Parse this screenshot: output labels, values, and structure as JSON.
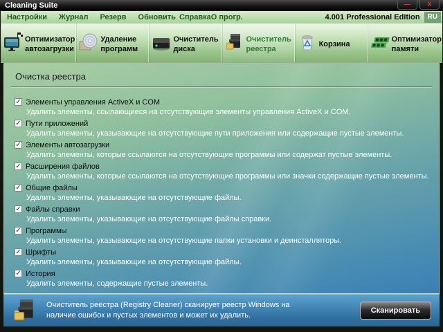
{
  "window": {
    "title": "Cleaning Suite",
    "minimize_label": "—",
    "close_label": "X"
  },
  "menu": {
    "items": [
      "Настройки",
      "Журнал",
      "Резерв",
      "Обновить",
      "Справка",
      "О прогр."
    ],
    "edition": "4.001 Professional Edition",
    "language": "RU"
  },
  "tabs": [
    {
      "label": "Оптимизатор автозагрузки",
      "icon": "startup-optimizer-icon",
      "active": false
    },
    {
      "label": "Удаление программ",
      "icon": "uninstall-icon",
      "active": false
    },
    {
      "label": "Очиститель диска",
      "icon": "disk-cleaner-icon",
      "active": false
    },
    {
      "label": "Очиститель реестра",
      "icon": "registry-cleaner-icon",
      "active": true
    },
    {
      "label": "Корзина",
      "icon": "recycle-bin-icon",
      "active": false
    },
    {
      "label": "Оптимизатор памяти",
      "icon": "memory-optimizer-icon",
      "active": false
    }
  ],
  "content": {
    "heading": "Очистка реестра",
    "items": [
      {
        "label": "Элементы управления ActiveX и COM",
        "description": "Удалить элементы, ссылающиеся на отсутствующие элементы управления ActiveX и COM.",
        "checked": true
      },
      {
        "label": "Пути приложений",
        "description": "Удалить элементы, указывающие на отсутствующие пути приложения или содержащие пустые элементы.",
        "checked": true
      },
      {
        "label": "Элементы автозагрузки",
        "description": "Удалить элементы, которые ссылаются на отсутствующие программы или содержат пустые элементы.",
        "checked": true
      },
      {
        "label": "Расширения файлов",
        "description": "Удалить элементы, которые ссылаются на отсутствующие программы или значки содержащие пустые элементы.",
        "checked": true
      },
      {
        "label": "Общие файлы",
        "description": "Удалить элементы, указывающие на отсутствующие файлы.",
        "checked": true
      },
      {
        "label": "Файлы справки",
        "description": "Удалить элементы, указывающие на отсутствующие файлы справки.",
        "checked": true
      },
      {
        "label": "Программы",
        "description": "Удалить элементы, указывающие на отсутствующие папки установки и деинсталляторы.",
        "checked": true
      },
      {
        "label": "Шрифты",
        "description": "Удалить элементы, указывающие на отсутствующие файлы.",
        "checked": true
      },
      {
        "label": "История",
        "description": "Удалить элементы, содержащие пустые элементы.",
        "checked": true
      }
    ]
  },
  "footer": {
    "description": "Очиститель реестра (Registry Cleaner) сканирует реестр Windows на наличие ошибок и пустых элементов и может их удалить.",
    "scan_button": "Сканировать"
  },
  "colors": {
    "accent_green": "#2e7d32",
    "menu_text_green": "#215c1c",
    "footer_background": "#32739f",
    "description_text": "#ffffff",
    "button_face": "#1c1c1c"
  }
}
